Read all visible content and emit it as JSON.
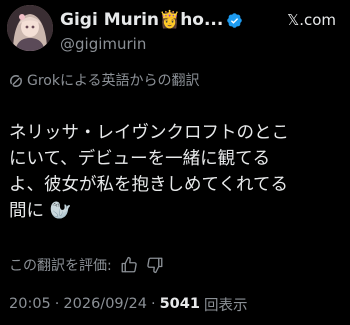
{
  "author": {
    "display_name": "Gigi Murin👸ho...",
    "handle": "@gigimurin",
    "verified_color": "#1d9bf0"
  },
  "brand": {
    "icon": "x-logo-icon",
    "label": "𝕏.com"
  },
  "translation": {
    "icon": "grok-icon",
    "label": "Grokによる英語からの翻訳"
  },
  "post": {
    "lines": [
      "ネリッサ・レイヴンクロフトのとこ",
      "にいて、デビューを一緒に観てる",
      "よ、彼女が私を抱きしめてくれてる",
      "間に 🦭"
    ]
  },
  "rating": {
    "label": "この翻訳を評価:",
    "like_icon": "thumbs-up-icon",
    "dislike_icon": "thumbs-down-icon"
  },
  "meta": {
    "time": "20:05",
    "separator": "·",
    "date": "2026/09/24",
    "views_count": "5041",
    "views_label": "回表示"
  }
}
